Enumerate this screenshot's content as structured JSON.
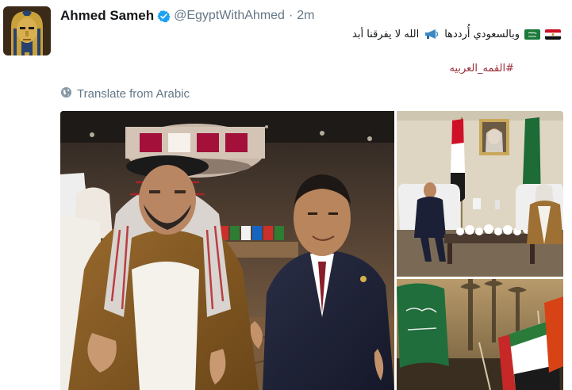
{
  "tweet": {
    "author": {
      "display_name": "Ahmed Sameh",
      "handle": "@EgyptWithAhmed",
      "verified": true,
      "avatar_icon": "pharaoh-mask-avatar"
    },
    "separator": "·",
    "timestamp": "2m",
    "text": "وبالسعودي أُرددها",
    "text_secondary": "الله لا يفرقنا أبد",
    "hashtag": "#القمه_العربيه",
    "translate_label": "Translate from Arabic",
    "icons": {
      "flag_1": "egypt-flag-icon",
      "flag_2": "saudi-flag-icon",
      "megaphone": "megaphone-icon",
      "globe": "globe-icon",
      "verified": "verified-badge-icon"
    },
    "media": {
      "count": 3
    }
  },
  "colors": {
    "text_primary": "#14171a",
    "text_secondary": "#657786",
    "hashtag": "#9b2c3a",
    "verified_badge": "#1da1f2"
  }
}
